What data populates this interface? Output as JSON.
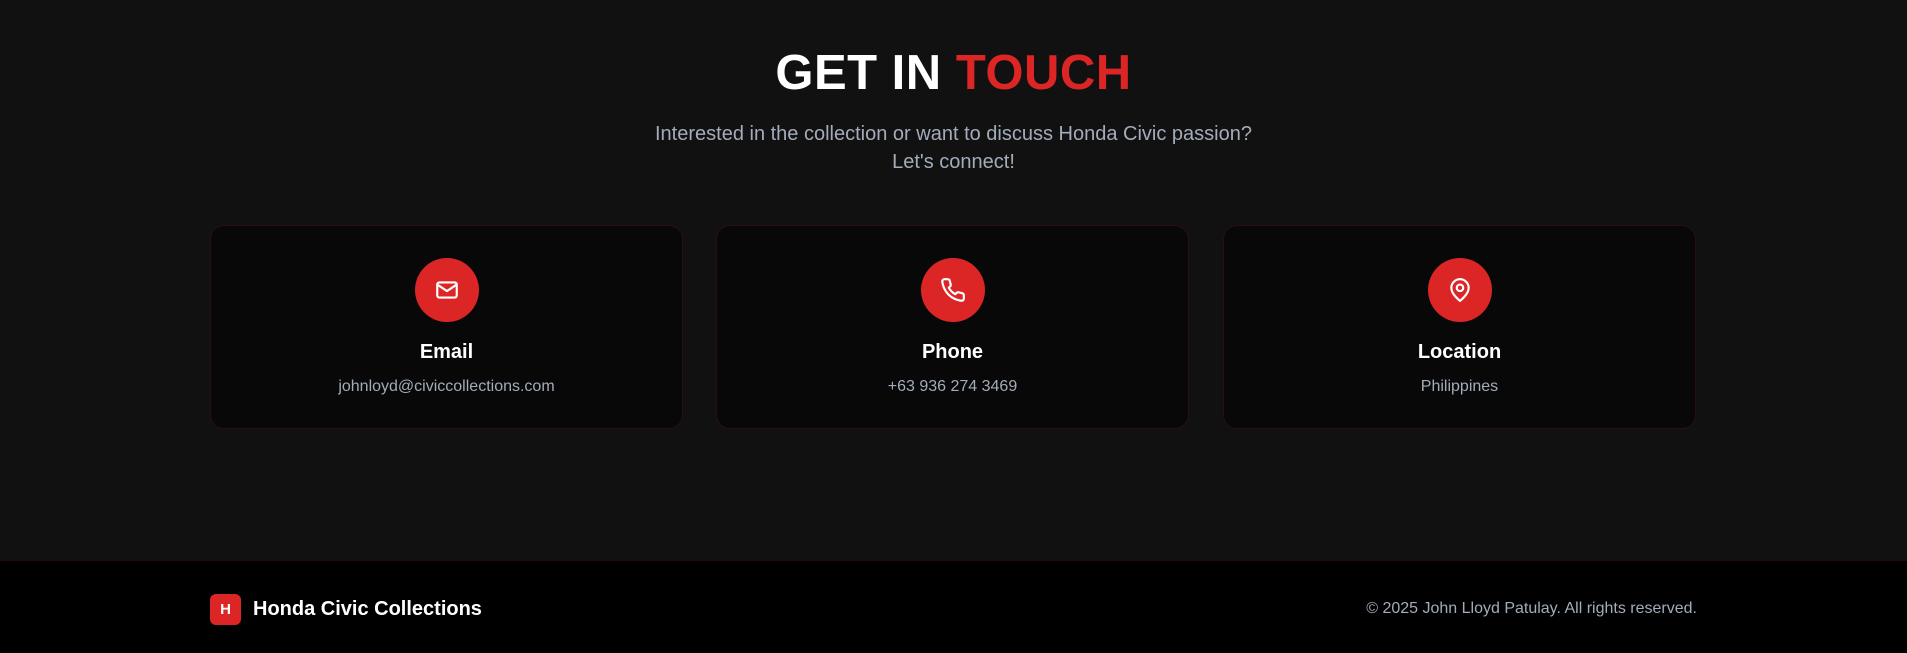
{
  "section": {
    "title_part1": "GET IN",
    "title_part2": "TOUCH",
    "subtitle_line1": "Interested in the collection or want to discuss Honda Civic passion?",
    "subtitle_line2": "Let's connect!"
  },
  "cards": [
    {
      "icon": "mail-icon",
      "title": "Email",
      "value": "johnloyd@civiccollections.com"
    },
    {
      "icon": "phone-icon",
      "title": "Phone",
      "value": "+63 936 274 3469"
    },
    {
      "icon": "map-pin-icon",
      "title": "Location",
      "value": "Philippines"
    }
  ],
  "footer": {
    "badge": "H",
    "brand": "Honda Civic Collections",
    "copyright": "© 2025 John Lloyd Patulay. All rights reserved."
  },
  "colors": {
    "accent": "#dc2626",
    "background": "#111111",
    "card": "#080808",
    "footer": "#000000",
    "muted_text": "#a3acba"
  }
}
